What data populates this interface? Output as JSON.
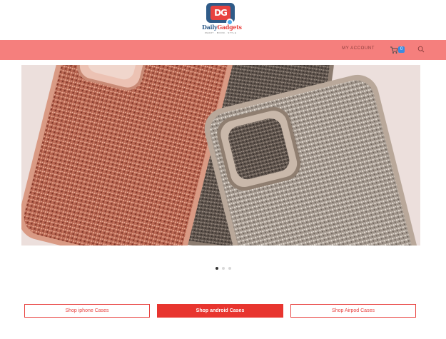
{
  "logo": {
    "badge_text": "DG",
    "name_part1": "Daily",
    "name_part2": "Gadgets",
    "tagline": "SMART · BOOM · STYLE"
  },
  "nav": {
    "account_label": "MY ACCOUNT",
    "cart_count": "0",
    "cart_icon": "cart-icon",
    "search_icon": "search-icon"
  },
  "hero": {
    "slide_count": 3,
    "active_slide": 1
  },
  "buttons": {
    "iphone": "Shop iphone Cases",
    "android": "Shop android Cases",
    "airpod": "Shop Airpod Cases"
  },
  "colors": {
    "navbar": "#f57f7d",
    "accent": "#e8423f",
    "brand_blue": "#2f5b88"
  }
}
